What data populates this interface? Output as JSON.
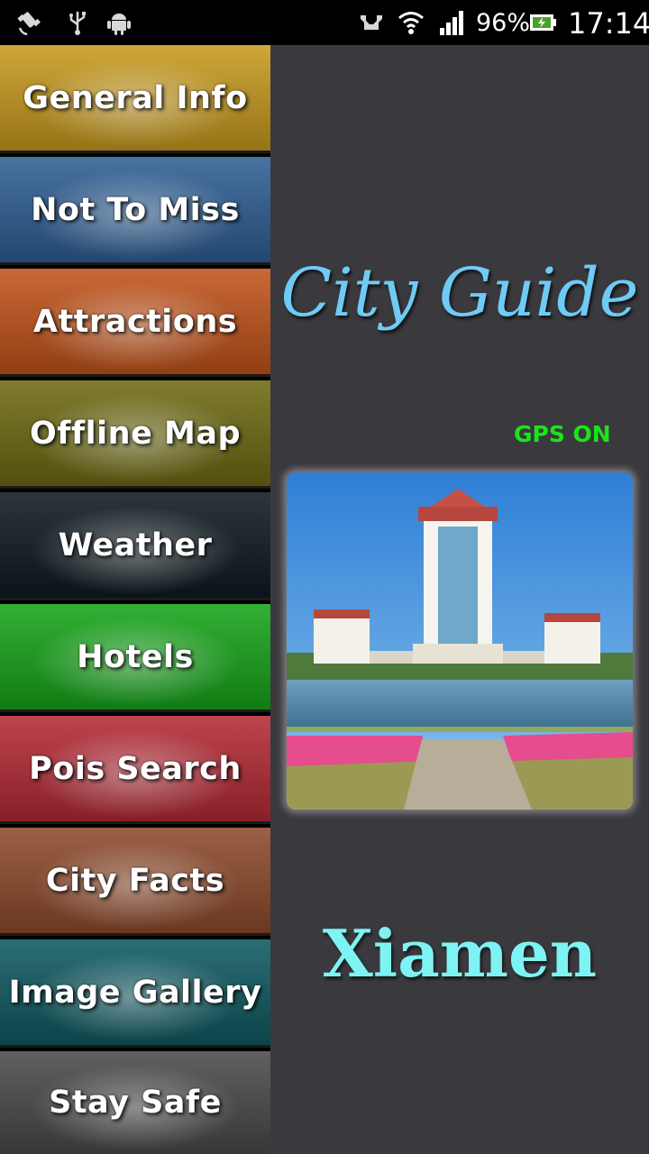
{
  "status_bar": {
    "battery_percent": "96%",
    "time": "17:14",
    "icons": [
      "satellite-icon",
      "usb-icon",
      "android-icon",
      "vibrate-icon",
      "wifi-icon",
      "signal-icon",
      "battery-icon"
    ]
  },
  "menu": {
    "items": [
      {
        "label": "General Info",
        "color": "#c89a1e"
      },
      {
        "label": "Not To Miss",
        "color": "#2f5f95"
      },
      {
        "label": "Attractions",
        "color": "#c2531a"
      },
      {
        "label": "Offline Map",
        "color": "#6e6a12"
      },
      {
        "label": "Weather",
        "color": "#0e1a20"
      },
      {
        "label": "Hotels",
        "color": "#17a51a"
      },
      {
        "label": "Pois Search",
        "color": "#b52a35"
      },
      {
        "label": "City Facts",
        "color": "#8e4a2b"
      },
      {
        "label": "Image Gallery",
        "color": "#0f5a62"
      },
      {
        "label": "Stay Safe",
        "color": "#4a4a4a"
      }
    ]
  },
  "main": {
    "title": "City Guide",
    "gps_status": "GPS ON",
    "city_name": "Xiamen"
  }
}
